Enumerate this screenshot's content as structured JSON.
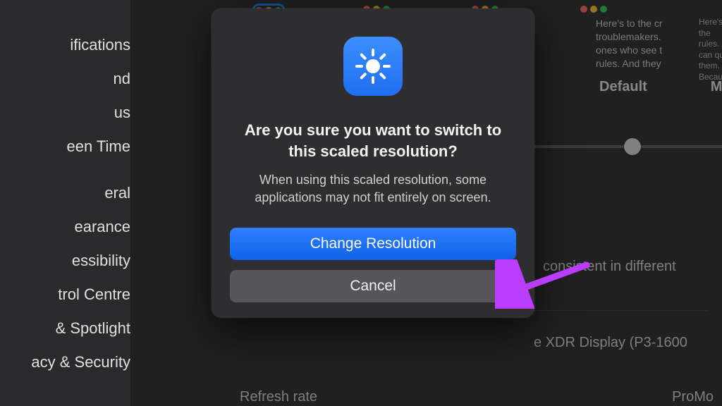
{
  "sidebar": {
    "items": [
      {
        "label": "ifications"
      },
      {
        "label": "nd"
      },
      {
        "label": "us"
      },
      {
        "label": "een Time"
      },
      {
        "label": "eral"
      },
      {
        "label": "earance"
      },
      {
        "label": "essibility"
      },
      {
        "label": "trol Centre"
      },
      {
        "label": "& Spotlight"
      },
      {
        "label": "acy & Security"
      }
    ]
  },
  "background": {
    "sample_text_1": "Here's to the cr\ntroublemakers.\nones who see t\nrules. And they",
    "sample_text_2": "Here's to the\nrules.\ncan qu\nthem.\nBecau",
    "labels": {
      "default": "Default",
      "more": "More"
    },
    "consistent": "consistent in different",
    "xdr": "e XDR Display (P3-1600",
    "refresh_label": "Refresh rate",
    "promo": "ProMo"
  },
  "dialog": {
    "title": "Are you sure you want to switch to this scaled resolution?",
    "body": "When using this scaled resolution, some applications may not fit entirely on screen.",
    "primary": "Change Resolution",
    "secondary": "Cancel"
  },
  "colors": {
    "accent": "#2f7fff",
    "annotation": "#b93cff"
  }
}
